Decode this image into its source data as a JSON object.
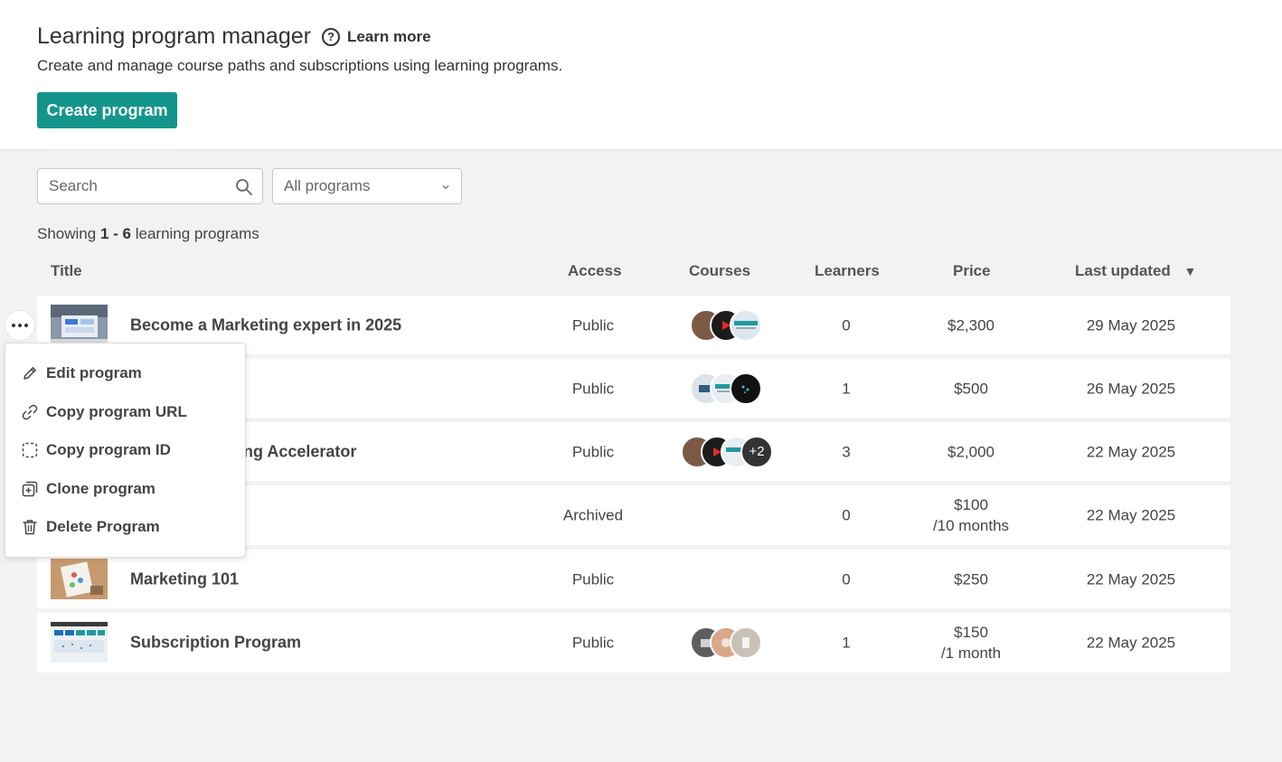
{
  "header": {
    "title": "Learning program manager",
    "help_icon": "question-circle-icon",
    "learn_more": "Learn more",
    "subtitle": "Create and manage course paths and subscriptions using learning programs.",
    "create_button": "Create program",
    "accent_color": "#14958b"
  },
  "filters": {
    "search_placeholder": "Search",
    "search_icon": "search-icon",
    "program_filter": "All programs"
  },
  "summary": {
    "prefix": "Showing",
    "range": "1 - 6",
    "suffix": "learning programs"
  },
  "table": {
    "columns": {
      "title": "Title",
      "access": "Access",
      "courses": "Courses",
      "learners": "Learners",
      "price": "Price",
      "last_updated": "Last updated"
    },
    "sort_indicator": "▼",
    "rows": [
      {
        "title": "Become a Marketing expert in 2025",
        "access": "Public",
        "courses_extra": "",
        "learners": "0",
        "price": "$2,300",
        "price_period": "",
        "last_updated": "29 May 2025"
      },
      {
        "title": "",
        "access": "Public",
        "courses_extra": "",
        "learners": "1",
        "price": "$500",
        "price_period": "",
        "last_updated": "26 May 2025"
      },
      {
        "title": "ng Accelerator",
        "access": "Public",
        "courses_extra": "+2",
        "learners": "3",
        "price": "$2,000",
        "price_period": "",
        "last_updated": "22 May 2025"
      },
      {
        "title": "",
        "access": "Archived",
        "courses_extra": "",
        "learners": "0",
        "price": "$100",
        "price_period": "/10 months",
        "last_updated": "22 May 2025"
      },
      {
        "title": "Marketing 101",
        "access": "Public",
        "courses_extra": "",
        "learners": "0",
        "price": "$250",
        "price_period": "",
        "last_updated": "22 May 2025"
      },
      {
        "title": "Subscription Program",
        "access": "Public",
        "courses_extra": "",
        "learners": "1",
        "price": "$150",
        "price_period": "/1 month",
        "last_updated": "22 May 2025"
      }
    ]
  },
  "context_menu": {
    "trigger_icon": "more-horizontal-icon",
    "items": [
      {
        "label": "Edit program",
        "icon": "pencil-icon"
      },
      {
        "label": "Copy program URL",
        "icon": "link-icon"
      },
      {
        "label": "Copy program ID",
        "icon": "dashed-id-icon"
      },
      {
        "label": "Clone program",
        "icon": "clone-icon"
      },
      {
        "label": "Delete Program",
        "icon": "trash-icon"
      }
    ]
  }
}
